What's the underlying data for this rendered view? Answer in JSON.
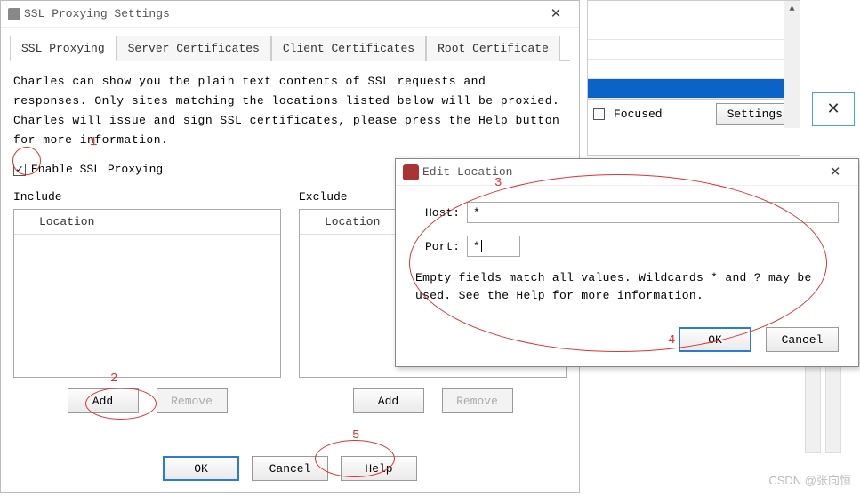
{
  "main": {
    "title": "SSL Proxying Settings",
    "tabs": [
      "SSL Proxying",
      "Server Certificates",
      "Client Certificates",
      "Root Certificate"
    ],
    "desc": "Charles can show you the plain text contents of SSL requests and responses. Only sites matching the locations listed below will be proxied. Charles will issue and sign SSL certificates, please press the Help button for more information.",
    "enable": "Enable SSL Proxying",
    "include": "Include",
    "exclude": "Exclude",
    "loc_header": "Location",
    "add": "Add",
    "remove": "Remove",
    "ok": "OK",
    "cancel": "Cancel",
    "help": "Help"
  },
  "right": {
    "focused": "Focused",
    "settings": "Settings"
  },
  "dlg": {
    "title": "Edit Location",
    "host_lbl": "Host:",
    "port_lbl": "Port:",
    "host_val": "*",
    "port_val": "*",
    "help": "Empty fields match all values. Wildcards * and ? may be used. See the Help for more information.",
    "ok": "OK",
    "cancel": "Cancel"
  },
  "annotations": {
    "n1": "1",
    "n2": "2",
    "n3": "3",
    "n4": "4",
    "n5": "5"
  },
  "watermark": "CSDN @张向恒"
}
